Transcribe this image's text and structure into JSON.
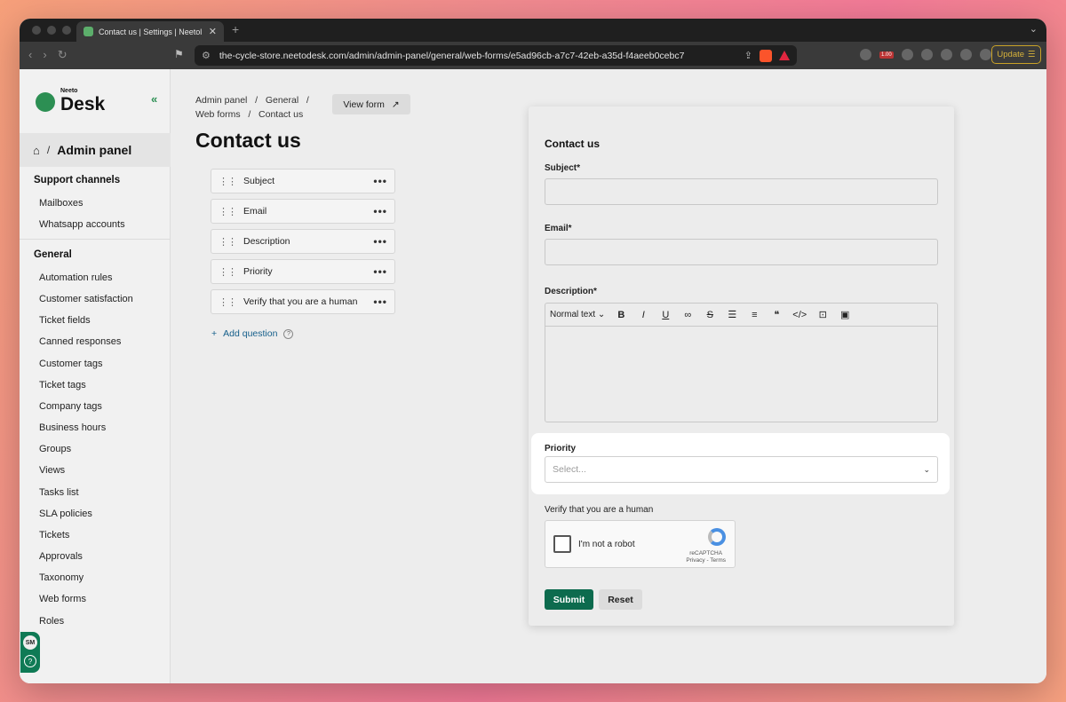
{
  "browser": {
    "tab_title": "Contact us | Settings | Neetol",
    "url": "the-cycle-store.neetodesk.com/admin/admin-panel/general/web-forms/e5ad96cb-a7c7-42eb-a35d-f4aeeb0cebc7",
    "update_label": "Update",
    "extension_badge": "1.00"
  },
  "sidebar": {
    "brand_small": "Neeto",
    "brand_big": "Desk",
    "crumb_label": "Admin panel",
    "sections": [
      {
        "title": "Support channels",
        "items": [
          "Mailboxes",
          "Whatsapp accounts"
        ]
      },
      {
        "title": "General",
        "items": [
          "Automation rules",
          "Customer satisfaction",
          "Ticket fields",
          "Canned responses",
          "Customer tags",
          "Ticket tags",
          "Company tags",
          "Business hours",
          "Groups",
          "Views",
          "Tasks list",
          "SLA policies",
          "Tickets",
          "Approvals",
          "Taxonomy",
          "Web forms",
          "Roles"
        ]
      }
    ],
    "avatar_initials": "SM",
    "help_glyph": "?"
  },
  "main": {
    "breadcrumb": [
      "Admin panel",
      "General",
      "Web forms",
      "Contact us"
    ],
    "view_form_label": "View form",
    "title": "Contact us",
    "questions": [
      "Subject",
      "Email",
      "Description",
      "Priority",
      "Verify that you are a human"
    ],
    "add_question_label": "Add question"
  },
  "preview": {
    "title": "Contact us",
    "subject_label": "Subject*",
    "email_label": "Email*",
    "description_label": "Description*",
    "rte_format": "Normal text",
    "priority_label": "Priority",
    "priority_placeholder": "Select...",
    "captcha_label": "Verify that you are a human",
    "captcha_text": "I'm not a robot",
    "captcha_brand": "reCAPTCHA",
    "captcha_links": "Privacy - Terms",
    "submit_label": "Submit",
    "reset_label": "Reset"
  }
}
